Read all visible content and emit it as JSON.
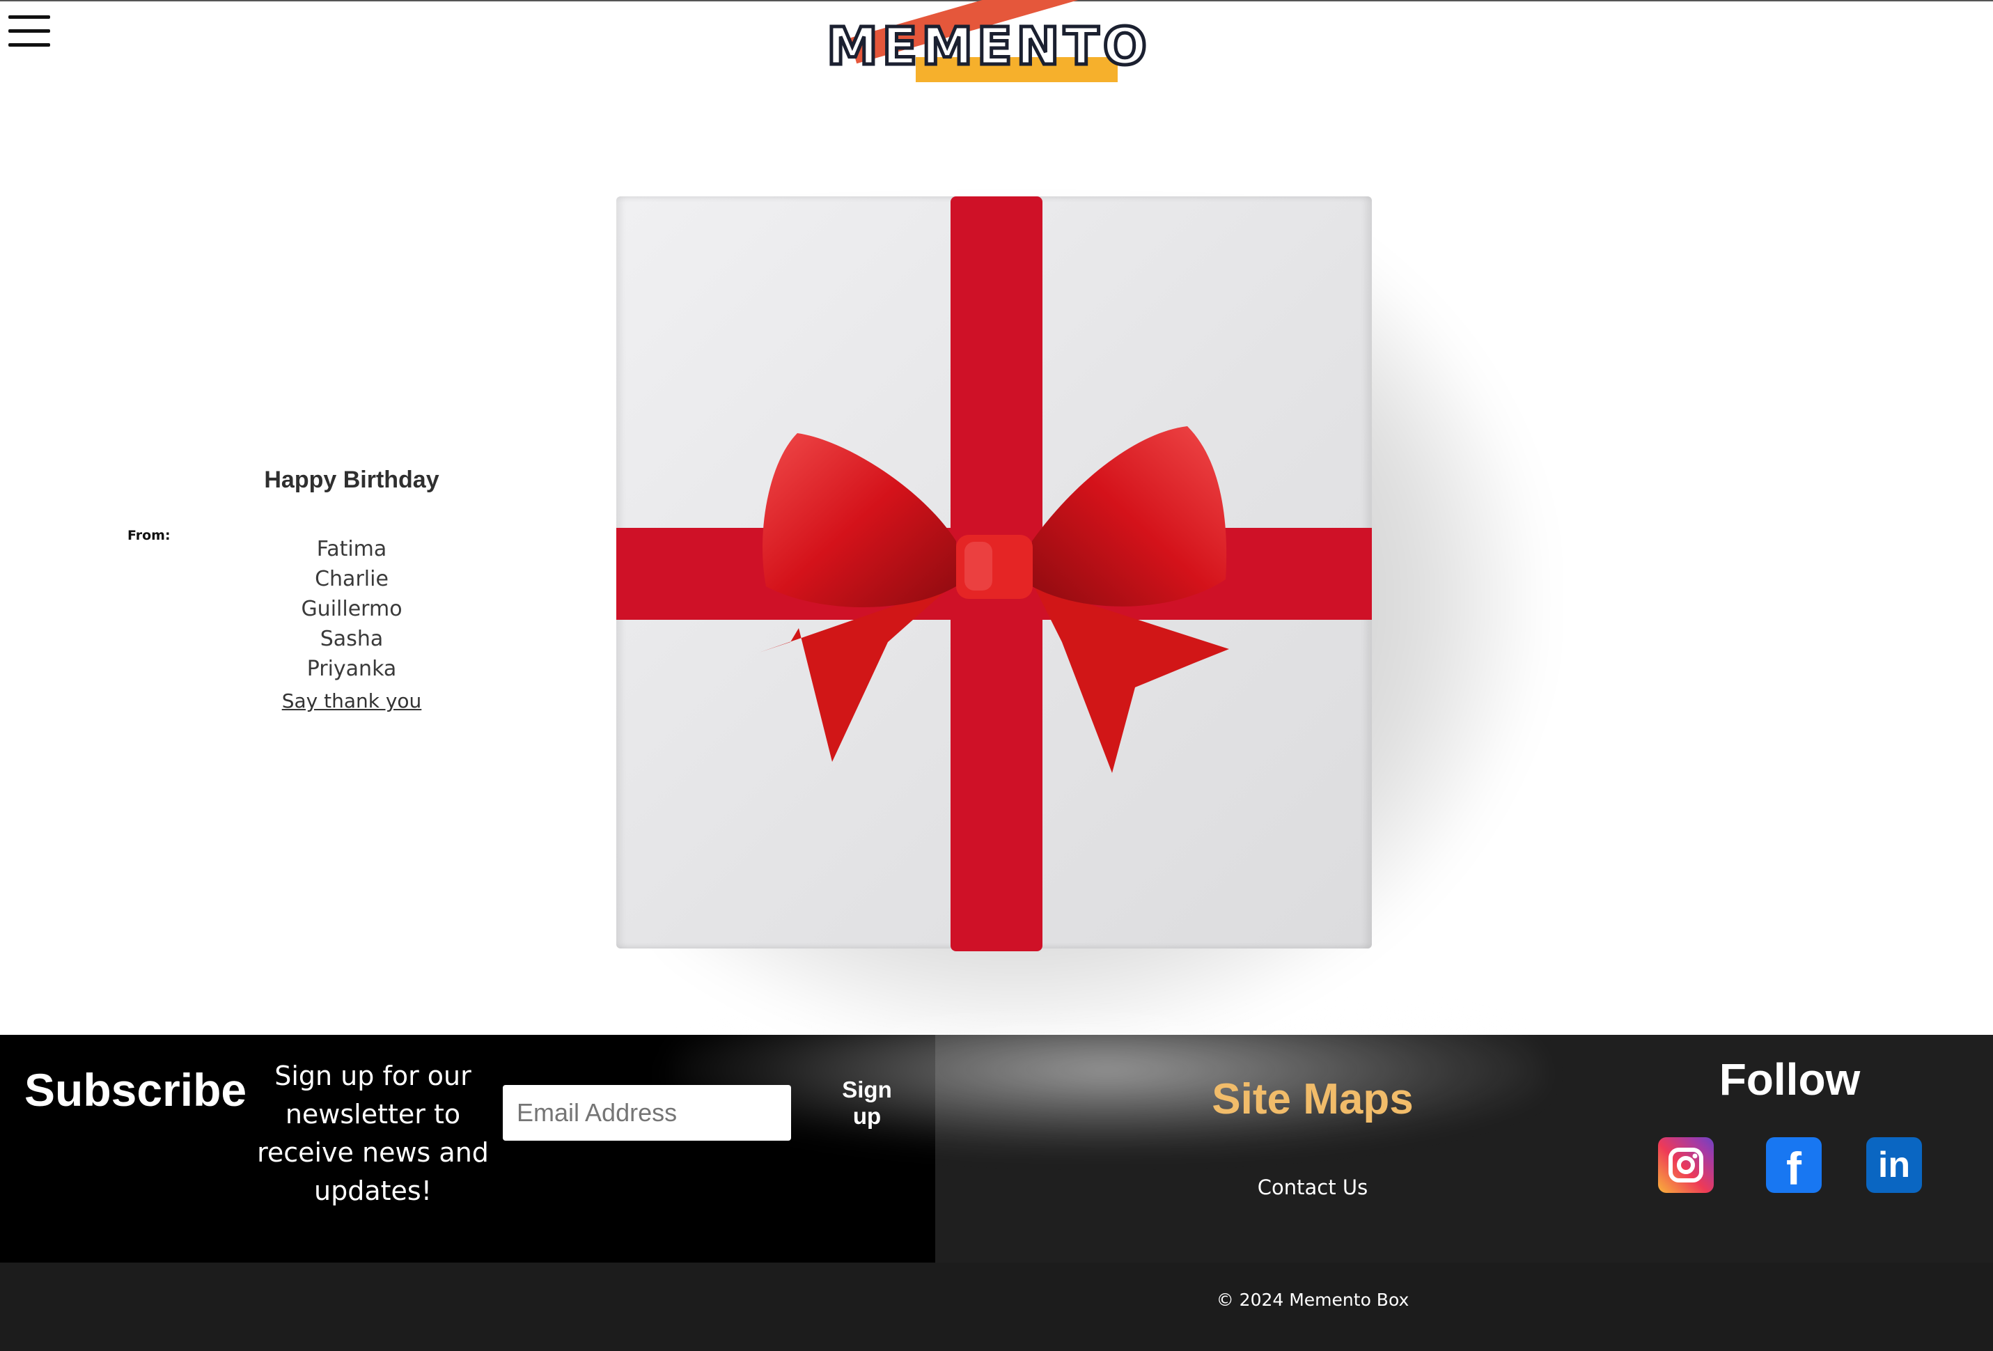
{
  "header": {
    "logo_text": "MEMENTO",
    "menu_icon": "hamburger-menu-icon"
  },
  "card": {
    "title": "Happy Birthday",
    "from_label": "From:",
    "names": [
      "Fatima",
      "Charlie",
      "Guillermo",
      "Sasha",
      "Priyanka"
    ],
    "thank_link": "Say thank you"
  },
  "gift": {
    "icon": "gift-box-icon",
    "ribbon_color": "#cf1127",
    "bow_color": "#e01a1a"
  },
  "footer": {
    "subscribe_title": "Subscribe",
    "subscribe_text": "Sign up for our newsletter to receive news and updates!",
    "email_placeholder": "Email Address",
    "signup_label": "Sign up",
    "sitemaps_title": "Site Maps",
    "contact_link": "Contact Us",
    "follow_title": "Follow",
    "social": [
      {
        "name": "instagram-icon",
        "color": "#e1306c"
      },
      {
        "name": "facebook-icon",
        "color": "#1877f2"
      },
      {
        "name": "linkedin-icon",
        "color": "#0a66c2"
      }
    ],
    "copyright": "© 2024 Memento Box",
    "colors": {
      "subscribe_bg": "#000000",
      "sitemap_bg": "#1f1f1f",
      "sitemap_heading": "#f1bc6a"
    }
  }
}
